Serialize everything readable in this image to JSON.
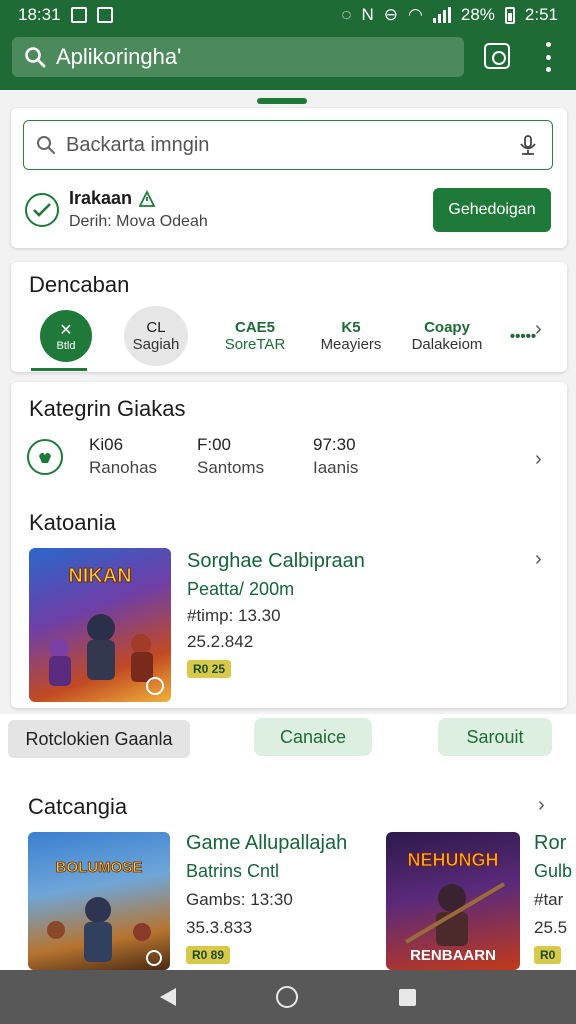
{
  "status_bar": {
    "time": "18:31",
    "battery": "28%",
    "clock_right": "2:51"
  },
  "app_bar": {
    "search_text": "Aplikoringha'"
  },
  "search_card": {
    "placeholder": "Backarta imngin",
    "verified_title": "Irakaan",
    "verified_subtitle": "Derih: Mova Odeah",
    "action_button": "Gehedoigan"
  },
  "discover": {
    "title": "Dencaban",
    "tabs": [
      {
        "top": "",
        "bottom": "Btld"
      },
      {
        "top": "CL",
        "bottom": "Sagiah"
      },
      {
        "top": "CAE5",
        "bottom": "SoreTAR"
      },
      {
        "top": "K5",
        "bottom": "Meayiers"
      },
      {
        "top": "Coapy",
        "bottom": "Dalakeiom"
      }
    ],
    "more_dots": "•••••"
  },
  "categories": {
    "title": "Kategrin Giakas",
    "stats": [
      {
        "top": "Ki06",
        "bottom": "Ranohas"
      },
      {
        "top": "F:00",
        "bottom": "Santoms"
      },
      {
        "top": "97:30",
        "bottom": "Iaanis"
      }
    ],
    "subsection_title": "Katoania",
    "featured": {
      "art_label": "NIKAN",
      "title": "Sorghae Calbipraan",
      "subtitle": "Peatta/ 200m",
      "meta1": "#timp: 13.30",
      "meta2": "25.2.842",
      "badge": "R0 25"
    }
  },
  "chips": {
    "left": "Rotclokien Gaanla",
    "middle": "Canaice",
    "right": "Sarouit"
  },
  "bottom_section": {
    "title": "Catcangia",
    "items": [
      {
        "art_label": "BOLUMOSE",
        "title": "Game Allupallajah",
        "subtitle": "Batrins Cntl",
        "meta1": "Gambs: 13:30",
        "meta2": "35.3.833",
        "badge": "R0 89"
      },
      {
        "art_label": "NEHUNGH",
        "art_bottom": "RENBAARN",
        "title": "Ror",
        "subtitle": "Gulb",
        "meta1": "#tar",
        "meta2": "25.5",
        "badge": "R0"
      }
    ]
  },
  "colors": {
    "primary": "#1f6b35",
    "accent": "#1f7a3a",
    "title_green": "#16643a",
    "badge": "#d8c94a"
  }
}
